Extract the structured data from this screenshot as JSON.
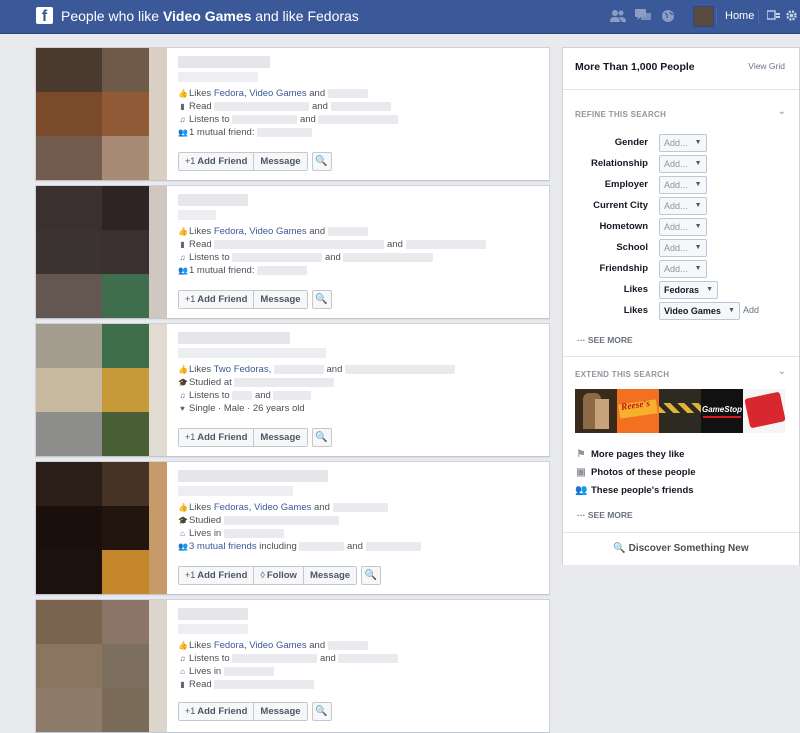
{
  "topbar": {
    "title_prefix": "People who like ",
    "title_bold": "Video Games",
    "title_suffix": " and like Fedoras",
    "home_label": "Home",
    "icons": [
      "friend-requests-icon",
      "messages-icon",
      "notifications-globe-icon",
      "settings-gear-icon",
      "privacy-shortcut-icon"
    ]
  },
  "results": [
    {
      "lines": [
        {
          "icon": "thumbs-up-icon",
          "prefix": "Likes ",
          "links": [
            "Fedora",
            ", ",
            "Video Games"
          ],
          "suffix": " and"
        },
        {
          "icon": "book-icon",
          "prefix": "Read",
          "links": [],
          "suffix": "and"
        },
        {
          "icon": "music-note-icon",
          "prefix": "Listens to",
          "links": [],
          "suffix": "and"
        },
        {
          "icon": "mutual-friends-icon",
          "prefix": "1 mutual friend:",
          "links": [],
          "suffix": ""
        }
      ],
      "buttons": {
        "add_friend": "Add Friend",
        "message": "Message"
      }
    },
    {
      "lines": [
        {
          "icon": "thumbs-up-icon",
          "prefix": "Likes ",
          "links": [
            "Fedora",
            ", ",
            "Video Games"
          ],
          "suffix": " and"
        },
        {
          "icon": "book-icon",
          "prefix": "Read",
          "links": [],
          "suffix": "and"
        },
        {
          "icon": "music-note-icon",
          "prefix": "Listens to",
          "links": [],
          "suffix": "and"
        },
        {
          "icon": "mutual-friends-icon",
          "prefix": "1 mutual friend:",
          "links": [],
          "suffix": ""
        }
      ],
      "buttons": {
        "add_friend": "Add Friend",
        "message": "Message"
      }
    },
    {
      "lines": [
        {
          "icon": "thumbs-up-icon",
          "prefix": "Likes ",
          "links": [
            "Two Fedoras,"
          ],
          "suffix": "and"
        },
        {
          "icon": "graduation-cap-icon",
          "prefix": "Studied at",
          "links": [],
          "suffix": ""
        },
        {
          "icon": "music-note-icon",
          "prefix": "Listens to",
          "links": [],
          "suffix": "and"
        },
        {
          "icon": "heart-icon",
          "prefix": "Single · Male · 26 years old",
          "links": [],
          "suffix": ""
        }
      ],
      "buttons": {
        "add_friend": "Add Friend",
        "message": "Message"
      }
    },
    {
      "lines": [
        {
          "icon": "thumbs-up-icon",
          "prefix": "Likes ",
          "links": [
            "Fedoras",
            ", ",
            "Video Games"
          ],
          "suffix": " and"
        },
        {
          "icon": "graduation-cap-icon",
          "prefix": "Studied",
          "links": [],
          "suffix": ""
        },
        {
          "icon": "home-icon",
          "prefix": "Lives in",
          "links": [],
          "suffix": ""
        },
        {
          "icon": "mutual-friends-icon",
          "prefix": "",
          "links": [
            "3 mutual friends"
          ],
          "suffix": " including"
        }
      ],
      "buttons": {
        "add_friend": "Add Friend",
        "follow": "Follow",
        "message": "Message"
      }
    },
    {
      "lines": [
        {
          "icon": "thumbs-up-icon",
          "prefix": "Likes ",
          "links": [
            "Fedora",
            ", ",
            "Video Games"
          ],
          "suffix": " and"
        },
        {
          "icon": "music-note-icon",
          "prefix": "Listens to",
          "links": [],
          "suffix": "and"
        },
        {
          "icon": "home-icon",
          "prefix": "Lives in",
          "links": [],
          "suffix": ""
        },
        {
          "icon": "book-icon",
          "prefix": "Read",
          "links": [],
          "suffix": ""
        }
      ],
      "buttons": {
        "add_friend": "Add Friend",
        "message": "Message"
      }
    }
  ],
  "sidebar": {
    "heading": "More Than 1,000 People",
    "view_grid": "View Grid",
    "refine_title": "REFINE THIS SEARCH",
    "filters": [
      {
        "label": "Gender",
        "value": "Add...",
        "selected": false
      },
      {
        "label": "Relationship",
        "value": "Add...",
        "selected": false
      },
      {
        "label": "Employer",
        "value": "Add...",
        "selected": false
      },
      {
        "label": "Current City",
        "value": "Add...",
        "selected": false
      },
      {
        "label": "Hometown",
        "value": "Add...",
        "selected": false
      },
      {
        "label": "School",
        "value": "Add...",
        "selected": false
      },
      {
        "label": "Friendship",
        "value": "Add...",
        "selected": false
      },
      {
        "label": "Likes",
        "value": "Fedoras",
        "selected": true
      },
      {
        "label": "Likes",
        "value": "Video Games",
        "selected": true
      }
    ],
    "add_label": "Add",
    "see_more_1": "SEE MORE",
    "extend_title": "EXTEND THIS SEARCH",
    "thumbs": [
      {
        "name": "movie-thumb",
        "text": ""
      },
      {
        "name": "reeses-thumb",
        "text": "Reese's"
      },
      {
        "name": "caution-thumb",
        "text": ""
      },
      {
        "name": "gamestop-thumb",
        "text": "GameStop"
      },
      {
        "name": "red-badge-thumb",
        "text": ""
      }
    ],
    "extend_links": [
      {
        "icon": "flag-icon",
        "label": "More pages they like"
      },
      {
        "icon": "photos-icon",
        "label": "Photos of these people"
      },
      {
        "icon": "friends-icon",
        "label": "These people's friends"
      }
    ],
    "see_more_2": "SEE MORE",
    "discover": "Discover Something New"
  }
}
